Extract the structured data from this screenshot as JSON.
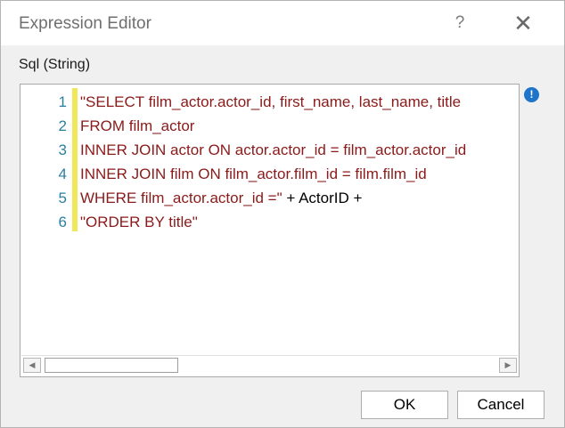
{
  "window": {
    "title": "Expression Editor",
    "help_glyph": "?",
    "close_glyph": "✕"
  },
  "field": {
    "label": "Sql (String)"
  },
  "editor": {
    "line_numbers": [
      "1",
      "2",
      "3",
      "4",
      "5",
      "6"
    ],
    "lines": [
      {
        "parts": [
          {
            "text": "\"SELECT film_actor.actor_id, first_name, last_name, title",
            "kind": "string"
          }
        ]
      },
      {
        "parts": [
          {
            "text": "FROM film_actor",
            "kind": "string"
          }
        ]
      },
      {
        "parts": [
          {
            "text": "INNER JOIN actor ON actor.actor_id = film_actor.actor_id",
            "kind": "string"
          }
        ]
      },
      {
        "parts": [
          {
            "text": "INNER JOIN film ON film_actor.film_id = film.film_id",
            "kind": "string"
          }
        ]
      },
      {
        "parts": [
          {
            "text": "WHERE film_actor.actor_id =\"",
            "kind": "string"
          },
          {
            "text": " + ActorID +",
            "kind": "plain"
          }
        ]
      },
      {
        "parts": [
          {
            "text": "\"ORDER BY title\"",
            "kind": "string"
          }
        ]
      }
    ]
  },
  "info_icon": {
    "glyph": "!",
    "icon": "info-icon"
  },
  "colors": {
    "string_literal": "#8b1a1a",
    "line_number": "#2b7fa0",
    "change_bar": "#f0e85a",
    "info_icon": "#1e74c8"
  },
  "buttons": {
    "ok_label": "OK",
    "cancel_label": "Cancel"
  }
}
